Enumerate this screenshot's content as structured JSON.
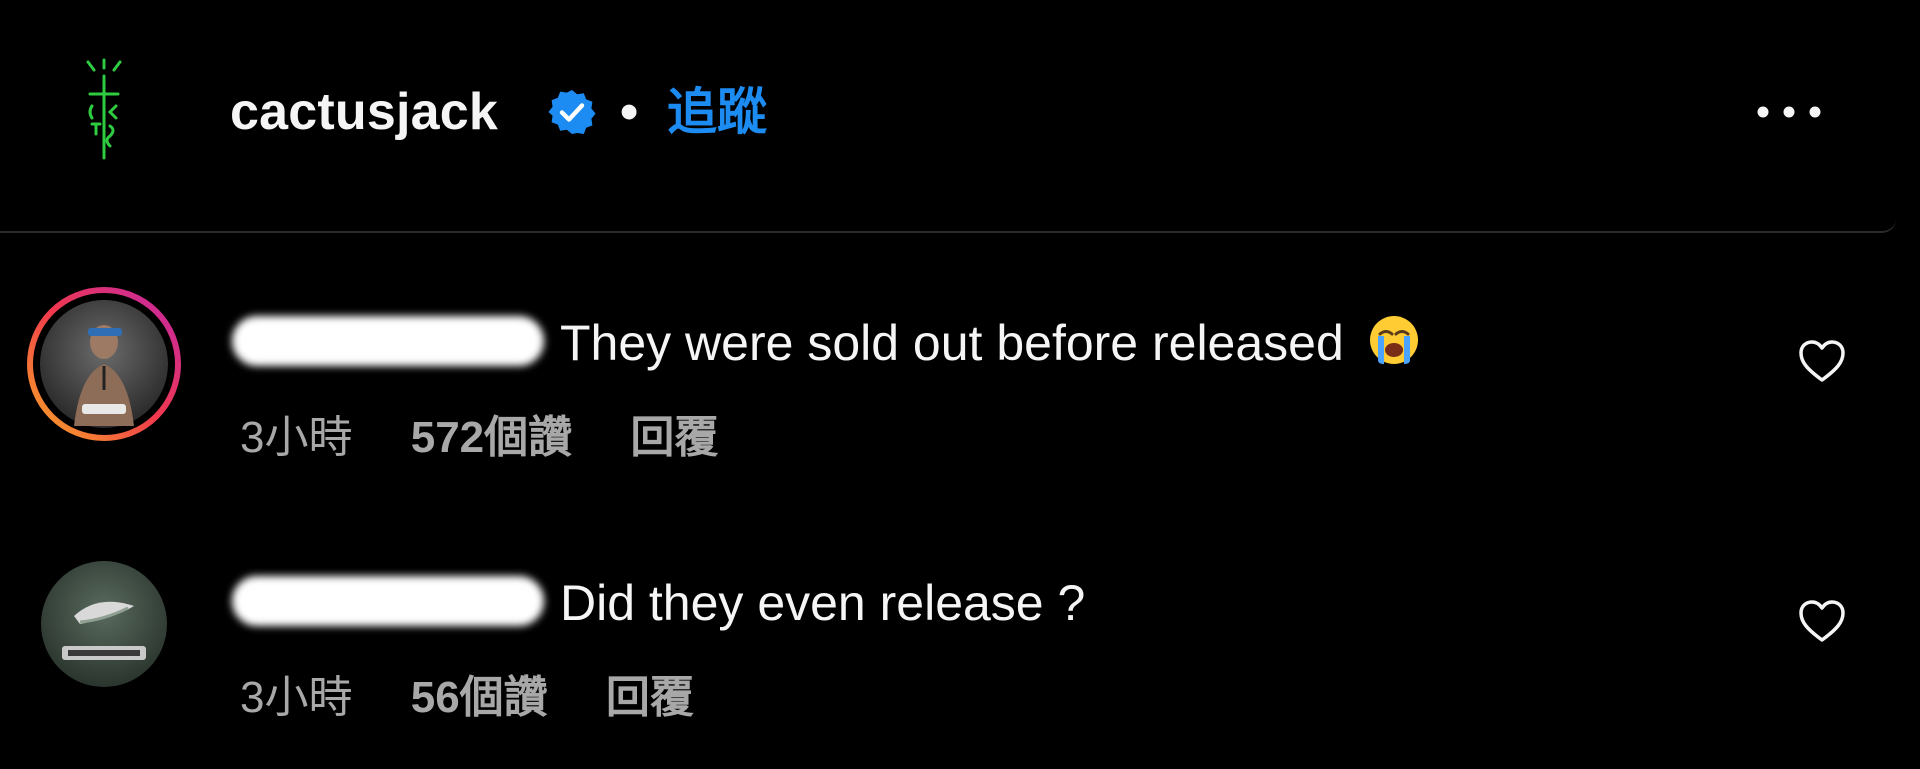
{
  "post_header": {
    "username": "cactusjack",
    "separator": "•",
    "follow_label": "追蹤",
    "accent_color": "#1d8cf2",
    "verified_icon": "verified-badge-icon",
    "more_icon": "more-options-icon"
  },
  "comments": [
    {
      "text": "They were sold out before released",
      "emoji": "loudly-crying-face-emoji",
      "time": "3小時",
      "likes": "572個讚",
      "reply_label": "回覆",
      "avatar_ring": true
    },
    {
      "text": "Did they even release ?",
      "time": "3小時",
      "likes": "56個讚",
      "reply_label": "回覆",
      "avatar_ring": false
    }
  ]
}
